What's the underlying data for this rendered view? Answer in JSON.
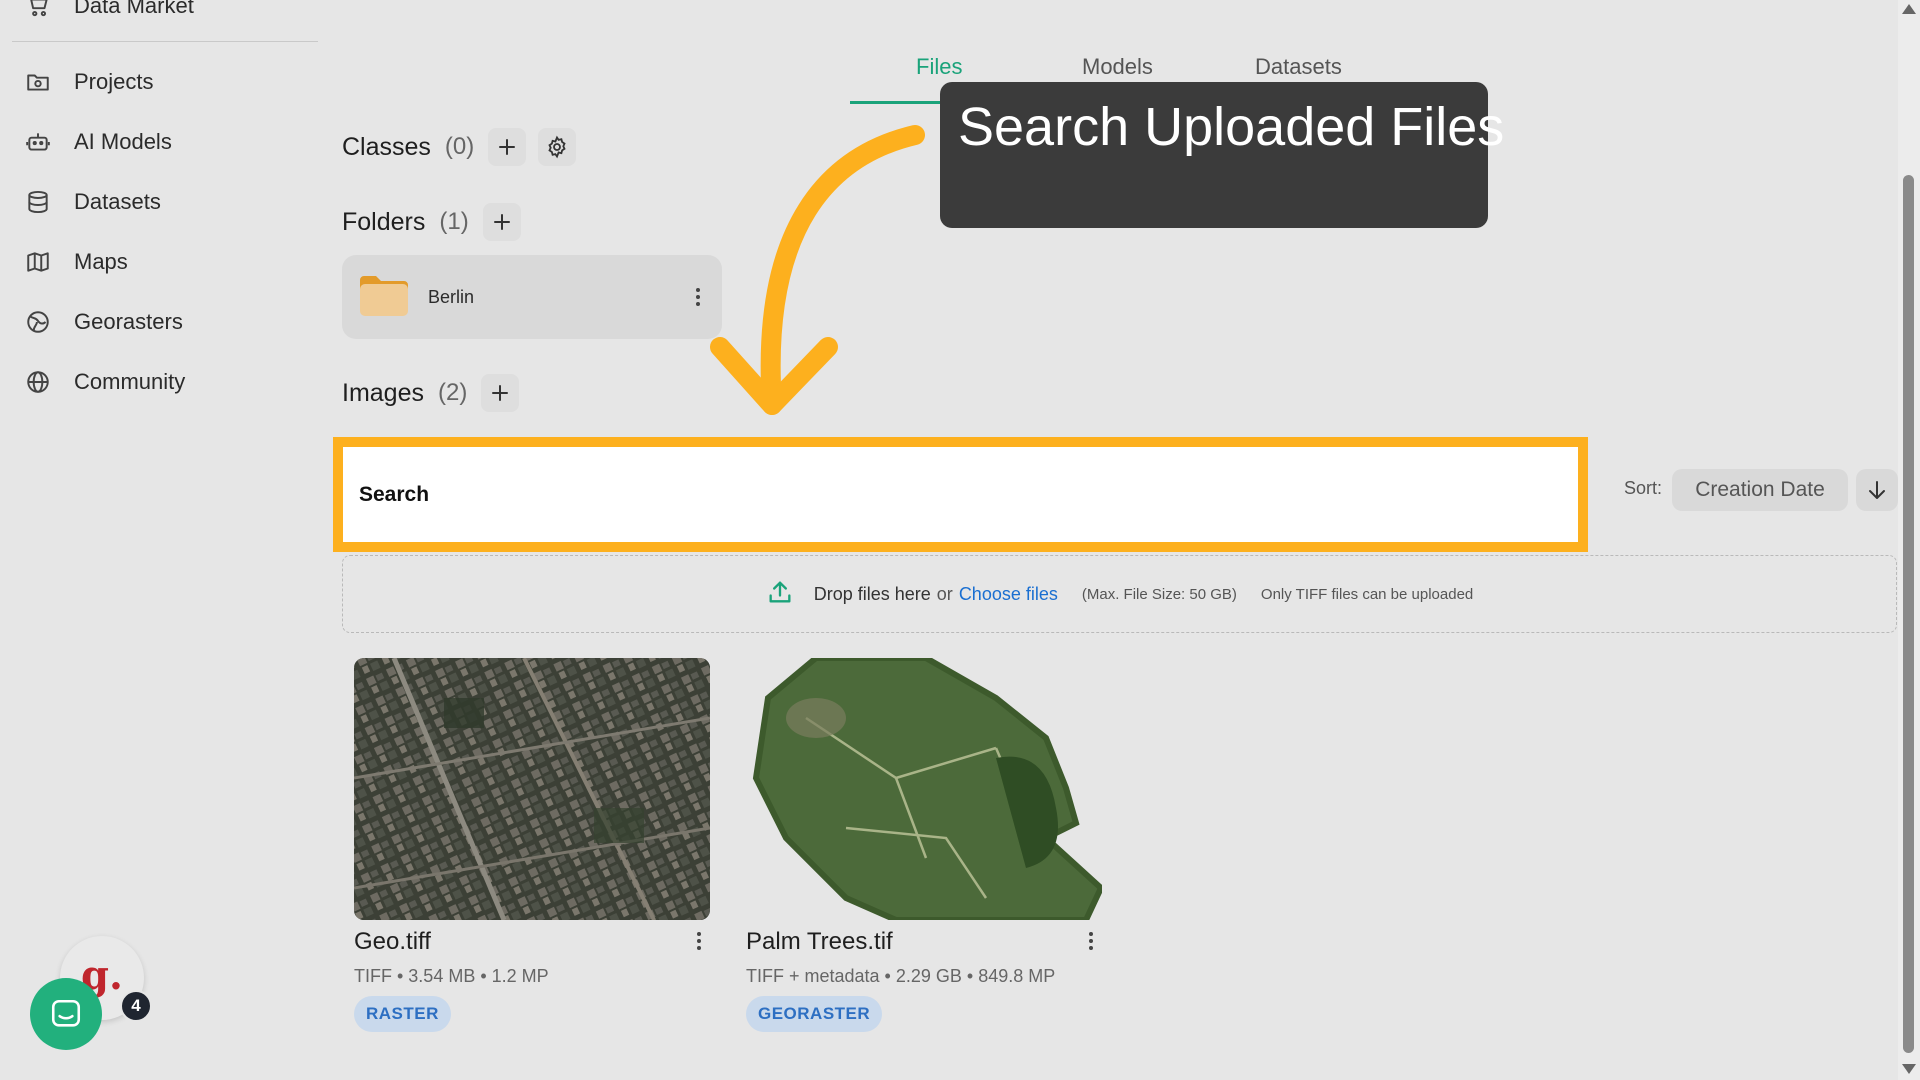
{
  "sidebar": {
    "items": [
      {
        "label": "Data Market",
        "icon": "cart-icon"
      },
      {
        "label": "Projects",
        "icon": "folder-icon"
      },
      {
        "label": "AI Models",
        "icon": "robot-icon"
      },
      {
        "label": "Datasets",
        "icon": "database-icon"
      },
      {
        "label": "Maps",
        "icon": "map-icon"
      },
      {
        "label": "Georasters",
        "icon": "globe-grid-icon"
      },
      {
        "label": "Community",
        "icon": "globe-icon"
      }
    ]
  },
  "tabs": [
    {
      "label": "Files",
      "active": true
    },
    {
      "label": "Models",
      "active": false
    },
    {
      "label": "Datasets",
      "active": false
    }
  ],
  "classes": {
    "title": "Classes",
    "count": "(0)"
  },
  "folders": {
    "title": "Folders",
    "count": "(1)",
    "items": [
      {
        "name": "Berlin"
      }
    ]
  },
  "images": {
    "title": "Images",
    "count": "(2)",
    "items": [
      {
        "name": "Geo.tiff",
        "meta": "TIFF • 3.54 MB • 1.2 MP",
        "badge": "RASTER"
      },
      {
        "name": "Palm Trees.tif",
        "meta": "TIFF + metadata • 2.29 GB • 849.8 MP",
        "badge": "GEORASTER"
      }
    ]
  },
  "search": {
    "placeholder": "Search"
  },
  "sort": {
    "label": "Sort:",
    "value": "Creation Date"
  },
  "dropzone": {
    "text": "Drop files here",
    "or": "or",
    "link": "Choose files",
    "max_size": "(Max. File Size: 50 GB)",
    "note": "Only TIFF files can be uploaded"
  },
  "callout": {
    "text": "Search Uploaded Files"
  },
  "widgets": {
    "avatar_letter": "g.",
    "notification_count": "4"
  },
  "colors": {
    "accent": "#1aa37a",
    "highlight": "#fdb01e",
    "link": "#1a6fd1",
    "badge_bg": "#c9d9ec",
    "badge_text": "#2d6fc2"
  }
}
